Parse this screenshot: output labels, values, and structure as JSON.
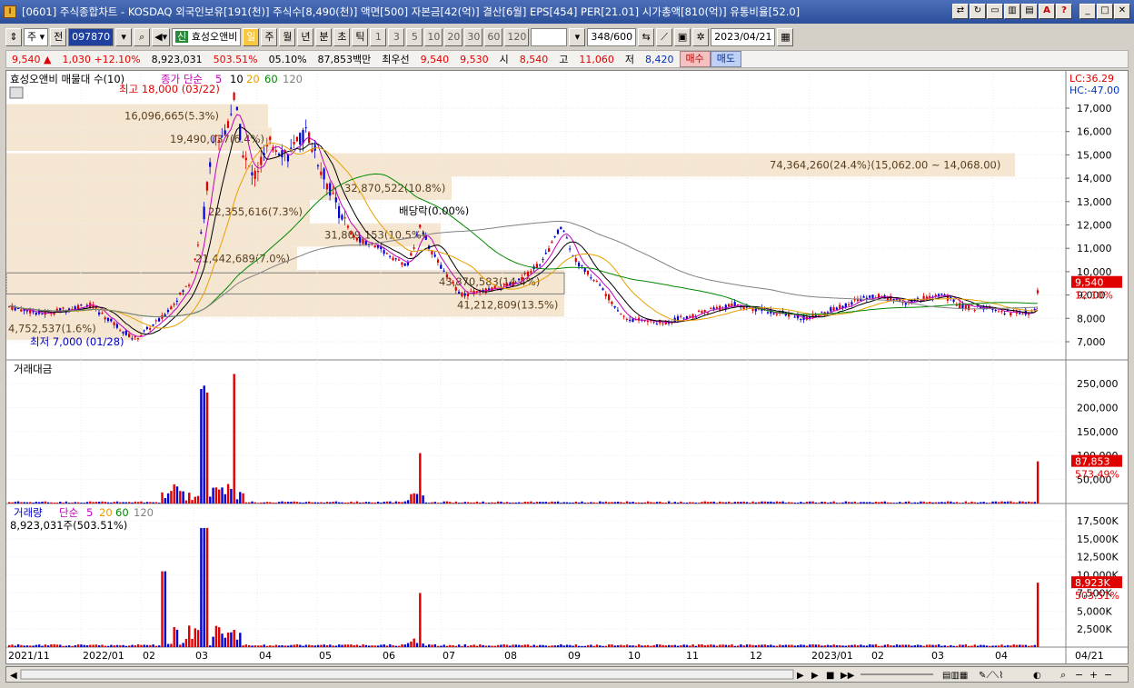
{
  "title": "[0601] 주식종합차트 - KOSDAQ 외국인보유[191(천)] 주식수[8,490(천)] 액면[500] 자본금[42(억)] 결산[6월] EPS[454] PER[21.01] 시가총액[810(억)] 유통비율[52.0]",
  "toolbar": {
    "type_label": "주",
    "prev_label": "전",
    "code": "097870",
    "company_tag": "신",
    "company_name": "효성오앤비",
    "periods": [
      "일",
      "주",
      "월",
      "년",
      "분",
      "초",
      "틱"
    ],
    "selected_period": "일",
    "intervals": [
      "1",
      "3",
      "5",
      "10",
      "20",
      "30",
      "60",
      "120"
    ],
    "count": "348",
    "count_total": "/600",
    "date": "2023/04/21"
  },
  "price": {
    "last": "9,540",
    "arrow": "▲",
    "change": "1,030",
    "change_pct": "+12.10%",
    "volume": "8,923,031",
    "volume_ratio": "503.51%",
    "turnover_pct": "05.10%",
    "amount": "87,853백만",
    "best_ask_label": "최우선",
    "best_ask": "9,540",
    "best_bid": "9,530",
    "open_label": "시",
    "open": "8,540",
    "high_label": "고",
    "high": "11,060",
    "low_label": "저",
    "low": "8,420",
    "buy_label": "매수",
    "sell_label": "매도"
  },
  "chart": {
    "legend_name": "효성오앤비 매물대 수(10)",
    "ma_label": "종가 단순",
    "ma_periods": [
      "5",
      "10",
      "20",
      "60",
      "120"
    ],
    "ma_colors": [
      "#c000c0",
      "#000000",
      "#e8a000",
      "#008800",
      "#808080"
    ],
    "lc_label": "LC:36.29",
    "hc_label": "HC:-47.00",
    "max_label": "최고 18,000 (03/22)",
    "min_label": "최저 7,000 (01/28)",
    "dividend_label": "배당락(0.00%)",
    "price_axis": [
      "17,000",
      "16,000",
      "15,000",
      "14,000",
      "13,000",
      "12,000",
      "11,000",
      "10,000",
      "9,000",
      "8,000",
      "7,000"
    ],
    "current_price_tag": "9,540",
    "current_pct_tag": "12.10%",
    "volume_profile": [
      {
        "label": "16,096,665(5.3%)",
        "price": 16670
      },
      {
        "label": "19,490,037(6.4%)",
        "price": 15670
      },
      {
        "label": "74,364,260(24.4%)(15,062.00 ~ 14,068.00)",
        "price": 14570
      },
      {
        "label": "32,870,522(10.8%)",
        "price": 13570
      },
      {
        "label": "22,355,616(7.3%)",
        "price": 12570
      },
      {
        "label": "31,809,153(10.5%)",
        "price": 11570
      },
      {
        "label": "21,442,689(7.0%)",
        "price": 10570
      },
      {
        "label": "43,870,583(14.4%)",
        "price": 9570
      },
      {
        "label": "41,212,809(13.5%)",
        "price": 8570
      },
      {
        "label": "4,752,537(1.6%)",
        "price": 7570
      }
    ],
    "amount_title": "거래대금",
    "amount_axis": [
      "250,000",
      "200,000",
      "150,000",
      "100,000",
      "50,000"
    ],
    "amount_tag": "87,853",
    "amount_pct_tag": "573.49%",
    "volume_title": "거래량",
    "volume_ma_label": "단순",
    "volume_total": "8,923,031주(503.51%)",
    "volume_axis": [
      "17,500K",
      "15,000K",
      "12,500K",
      "10,000K",
      "7,500K",
      "5,000K",
      "2,500K"
    ],
    "volume_tag": "8,923K",
    "volume_pct_tag": "503.51%",
    "date_axis": [
      "2021/11",
      "2022/01",
      "02",
      "03",
      "04",
      "05",
      "06",
      "07",
      "08",
      "09",
      "10",
      "11",
      "12",
      "2023/01",
      "02",
      "03",
      "04",
      "04/21"
    ]
  },
  "colors": {
    "up": "#e00000",
    "down": "#0000d0",
    "profile": "#f5e6d2",
    "tag": "#e00000"
  }
}
